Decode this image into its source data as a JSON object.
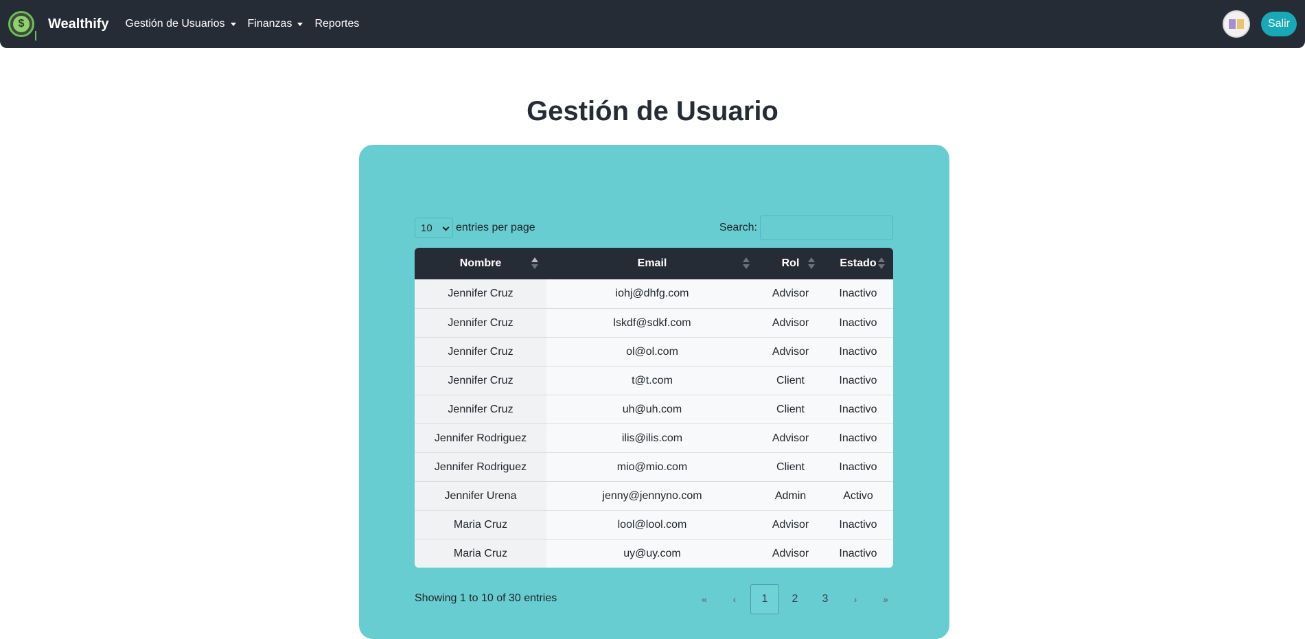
{
  "navbar": {
    "brand": "Wealthify",
    "logo_icon": "dollar-coin-icon",
    "menu": [
      {
        "label": "Gestión de Usuarios",
        "dropdown": true
      },
      {
        "label": "Finanzas",
        "dropdown": true
      },
      {
        "label": "Reportes",
        "dropdown": false
      }
    ],
    "exit_label": "Salir",
    "colors": {
      "background": "#262c36",
      "accent": "#17a9b6"
    }
  },
  "page": {
    "title": "Gestión de Usuario"
  },
  "table_controls": {
    "page_length": "10",
    "page_length_label": "entries per page",
    "search_label": "Search:",
    "search_value": ""
  },
  "table": {
    "columns": [
      "Nombre",
      "Email",
      "Rol",
      "Estado"
    ],
    "sorted_column": "Nombre",
    "rows": [
      [
        "Jennifer Cruz",
        "iohj@dhfg.com",
        "Advisor",
        "Inactivo"
      ],
      [
        "Jennifer Cruz",
        "lskdf@sdkf.com",
        "Advisor",
        "Inactivo"
      ],
      [
        "Jennifer Cruz",
        "ol@ol.com",
        "Advisor",
        "Inactivo"
      ],
      [
        "Jennifer Cruz",
        "t@t.com",
        "Client",
        "Inactivo"
      ],
      [
        "Jennifer Cruz",
        "uh@uh.com",
        "Client",
        "Inactivo"
      ],
      [
        "Jennifer Rodriguez",
        "ilis@ilis.com",
        "Advisor",
        "Inactivo"
      ],
      [
        "Jennifer Rodriguez",
        "mio@mio.com",
        "Client",
        "Inactivo"
      ],
      [
        "Jennifer Urena",
        "jenny@jennyno.com",
        "Admin",
        "Activo"
      ],
      [
        "Maria Cruz",
        "lool@lool.com",
        "Advisor",
        "Inactivo"
      ],
      [
        "Maria Cruz",
        "uy@uy.com",
        "Advisor",
        "Inactivo"
      ]
    ]
  },
  "footer": {
    "info": "Showing 1 to 10 of 30 entries",
    "pagination": {
      "first": "«",
      "prev": "‹",
      "pages": [
        "1",
        "2",
        "3"
      ],
      "current": "1",
      "next": "›",
      "last": "»"
    }
  },
  "colors": {
    "card": "#67cdd1",
    "table_header": "#262c36"
  }
}
